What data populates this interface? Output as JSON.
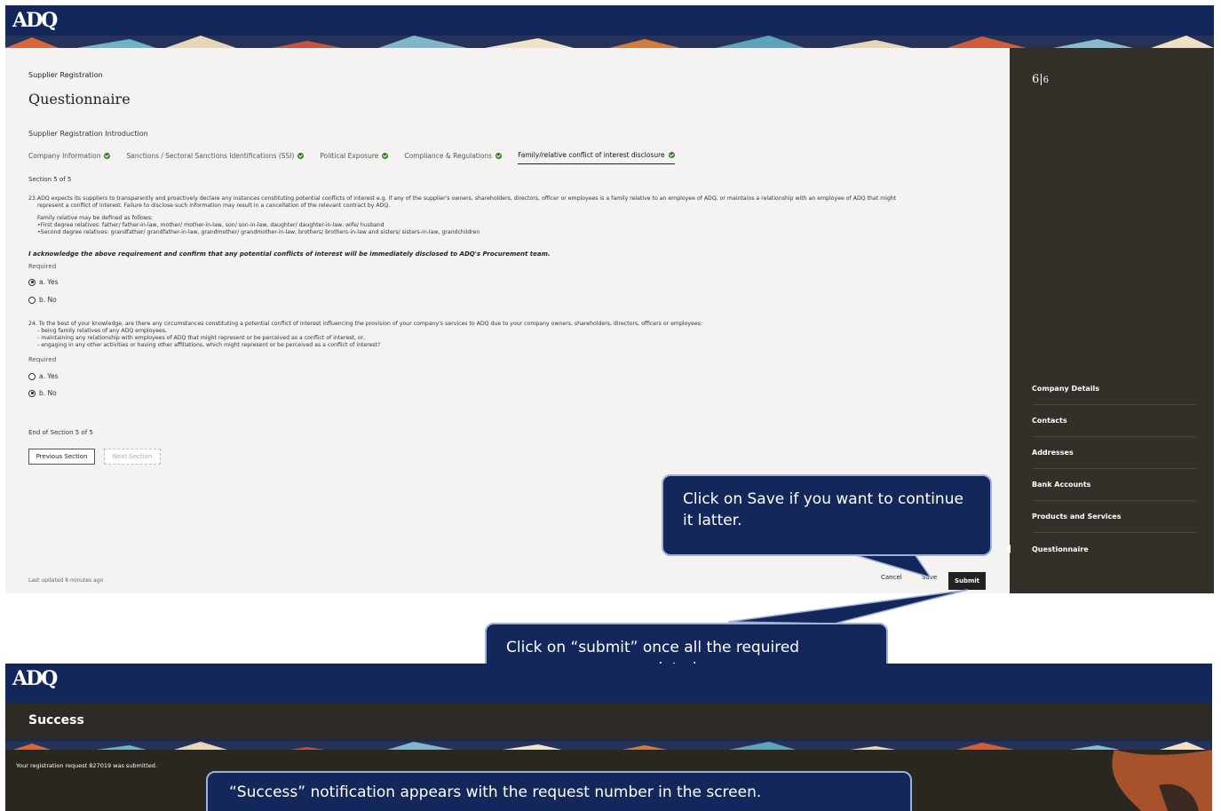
{
  "app": {
    "logo": "ADQ"
  },
  "page": {
    "breadcrumb": "Supplier Registration",
    "title": "Questionnaire",
    "intro": "Supplier Registration Introduction",
    "tabs": [
      {
        "label": "Company Information",
        "complete": true
      },
      {
        "label": "Sanctions / Sectoral Sanctions Identifications (SSI)",
        "complete": true
      },
      {
        "label": "Political Exposure",
        "complete": true
      },
      {
        "label": "Compliance & Regulations",
        "complete": true
      },
      {
        "label": "Family/relative conflict of interest disclosure",
        "complete": true,
        "active": true
      }
    ],
    "section_label": "Section 5 of 5",
    "q23": {
      "line1": "23.ADQ expects its suppliers to transparently and proactively declare any instances constituting potential conflicts of interest e.g. if any of the supplier's owners, shareholders, directors, officer or employees is a family relative to an employee of ADQ, or maintains a relationship with an employee of ADQ that might",
      "line2": "represent a conflict of interest. Failure to disclose such information may result in a cancellation of the relevant contract by ADQ.",
      "def1": "Family relative may be defined as follows:",
      "def2": "•First degree relatives: father/ father-in-law, mother/ mother-in-law, son/ son-in-law, daughter/ daughter-in-law, wife/ husband",
      "def3": "•Second degree relatives: grandfather/ grandfather-in-law, grandmother/ grandmother-in-law, brothers/ brothers-in-law and sisters/ sisters-in-law, grandchildren",
      "ack": "I acknowledge the above requirement and confirm that any potential conflicts of interest will be immediately disclosed to ADQ's Procurement team.",
      "required": "Required",
      "opt_yes": "a. Yes",
      "opt_no": "b. No",
      "selected": "yes"
    },
    "q24": {
      "line1": "24. To the best of your knowledge, are there any circumstances constituting a potential conflict of interest influencing the provision of your company's services to ADQ due to your company owners, shareholders, directors, officers or employees:",
      "b1": "- being family relatives of any ADQ employees,",
      "b2": "- maintaining any relationship with employees of ADQ that might represent or be perceived as a conflict of interest, or,",
      "b3": "- engaging in any other activities or having other affiliations, which might represent or be perceived as a conflict of interest?",
      "required": "Required",
      "opt_yes": "a. Yes",
      "opt_no": "b. No",
      "selected": "no"
    },
    "end_label": "End of Section 5 of 5",
    "prev_button": "Previous Section",
    "next_button": "Next Section",
    "last_updated": "Last updated 8 minutes ago",
    "cancel": "Cancel",
    "save": "Save",
    "submit": "Submit"
  },
  "sidebar": {
    "page_current": "6",
    "page_total": "6",
    "items": [
      "Company Details",
      "Contacts",
      "Addresses",
      "Bank Accounts",
      "Products and Services",
      "Questionnaire"
    ]
  },
  "callouts": {
    "save": "Click on Save if you want to continue it latter.",
    "submit": "Click on “submit” once all the required responses are completed.",
    "success": "“Success” notification appears with the request number in the screen."
  },
  "success_screen": {
    "logo": "ADQ",
    "heading": "Success",
    "message": "Your registration request 827019 was submitted."
  },
  "colors": {
    "navy": "#14275a",
    "panel": "#332f29",
    "accent_green": "#3a7d2c"
  }
}
